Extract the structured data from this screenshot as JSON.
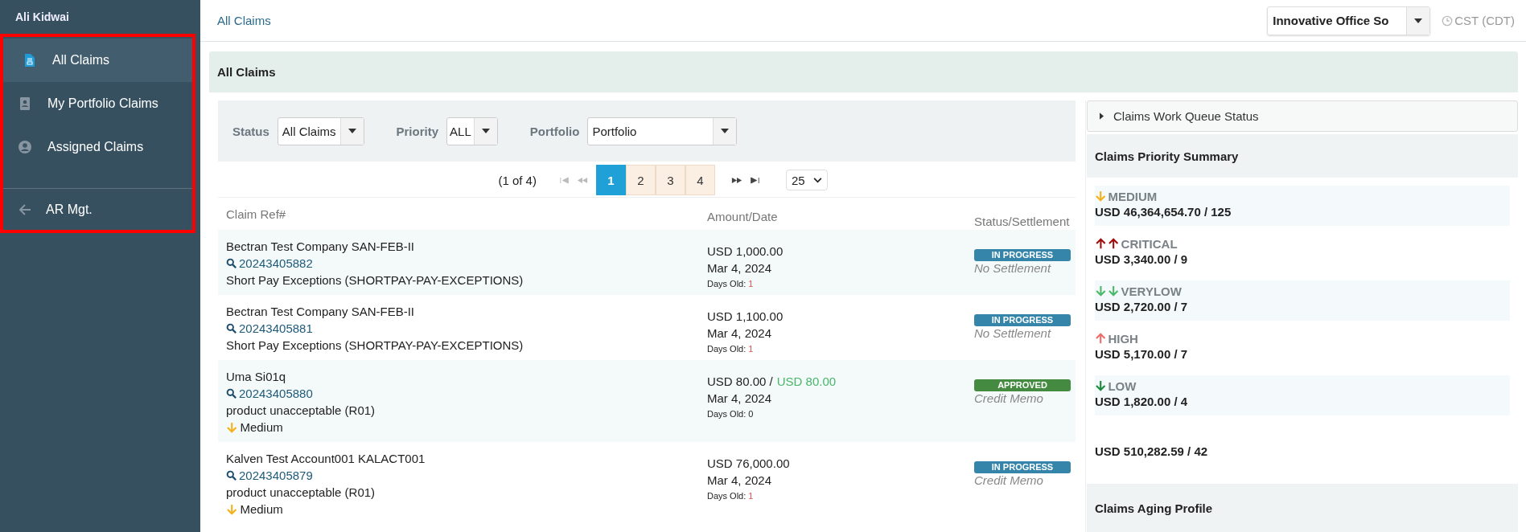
{
  "sidebar": {
    "user": "Ali Kidwai",
    "items": [
      {
        "label": "All Claims",
        "selected": true
      },
      {
        "label": "My Portfolio Claims",
        "selected": false
      },
      {
        "label": "Assigned Claims",
        "selected": false
      }
    ],
    "back": {
      "label": "AR Mgt."
    }
  },
  "header": {
    "breadcrumb": "All Claims",
    "company": "Innovative Office So",
    "timezone": "CST (CDT)"
  },
  "panel": {
    "title": "All Claims"
  },
  "filters": [
    {
      "label": "Status",
      "value": "All Claims"
    },
    {
      "label": "Priority",
      "value": "ALL"
    },
    {
      "label": "Portfolio",
      "value": "Portfolio"
    }
  ],
  "pagination": {
    "summary": "(1 of 4)",
    "pages": [
      {
        "label": "1",
        "selected": true
      },
      {
        "label": "2",
        "selected": false
      },
      {
        "label": "3",
        "selected": false
      },
      {
        "label": "4",
        "selected": false
      }
    ],
    "first_disabled": true,
    "last_disabled": false,
    "page_size": "25"
  },
  "table": {
    "columns": [
      "Claim Ref#",
      "Amount/Date",
      "Status/Settlement"
    ],
    "rows": [
      {
        "customer": "Bectran Test Company  SAN-FEB-II",
        "claim_number": "20243405882",
        "reason": "Short Pay Exceptions (SHORTPAY-PAY-EXCEPTIONS)",
        "amount": "USD 1,000.00",
        "date": "Mar 4, 2024",
        "days_label": "Days Old:",
        "days_old": "1",
        "days_alert": true,
        "status": {
          "label": "IN PROGRESS",
          "color": "#3585aa"
        },
        "settlement": "No Settlement"
      },
      {
        "customer": "Bectran Test Company  SAN-FEB-II",
        "claim_number": "20243405881",
        "reason": "Short Pay Exceptions (SHORTPAY-PAY-EXCEPTIONS)",
        "amount": "USD 1,100.00",
        "date": "Mar 4, 2024",
        "days_label": "Days Old:",
        "days_old": "1",
        "days_alert": true,
        "status": {
          "label": "IN PROGRESS",
          "color": "#3585aa"
        },
        "settlement": "No Settlement"
      },
      {
        "customer": "Uma  Si01q",
        "claim_number": "20243405880",
        "reason": "product unacceptable (R01)",
        "priority": "Medium",
        "amount": "USD 80.00 /",
        "settled_amount": "USD 80.00",
        "date": "Mar 4, 2024",
        "days_label": "Days Old:",
        "days_old": "0",
        "days_alert": false,
        "status": {
          "label": "APPROVED",
          "color": "#458a41"
        },
        "settlement": "Credit Memo"
      },
      {
        "customer": "Kalven Test Account001  KALACT001",
        "claim_number": "20243405879",
        "reason": "product unacceptable (R01)",
        "priority": "Medium",
        "amount": "USD 76,000.00",
        "date": "Mar 4, 2024",
        "days_label": "Days Old:",
        "days_old": "1",
        "days_alert": true,
        "status": {
          "label": "IN PROGRESS",
          "color": "#3585aa"
        },
        "settlement": "Credit Memo"
      }
    ]
  },
  "work_queue": {
    "title": "Claims Work Queue Status",
    "expanded": false
  },
  "priority_summary": {
    "title": "Claims Priority Summary",
    "items": [
      {
        "kind": "medium",
        "label": "MEDIUM",
        "value": "USD 46,364,654.70 / 125"
      },
      {
        "kind": "critical",
        "label": "CRITICAL",
        "value": "USD 3,340.00 / 9"
      },
      {
        "kind": "verylow",
        "label": "VERYLOW",
        "value": "USD 2,720.00 / 7"
      },
      {
        "kind": "high",
        "label": "HIGH",
        "value": "USD 5,170.00 / 7"
      },
      {
        "kind": "low",
        "label": "LOW",
        "value": "USD 1,820.00 / 4"
      }
    ],
    "total": "USD 510,282.59 / 42"
  },
  "aging": {
    "title": "Claims Aging Profile"
  }
}
